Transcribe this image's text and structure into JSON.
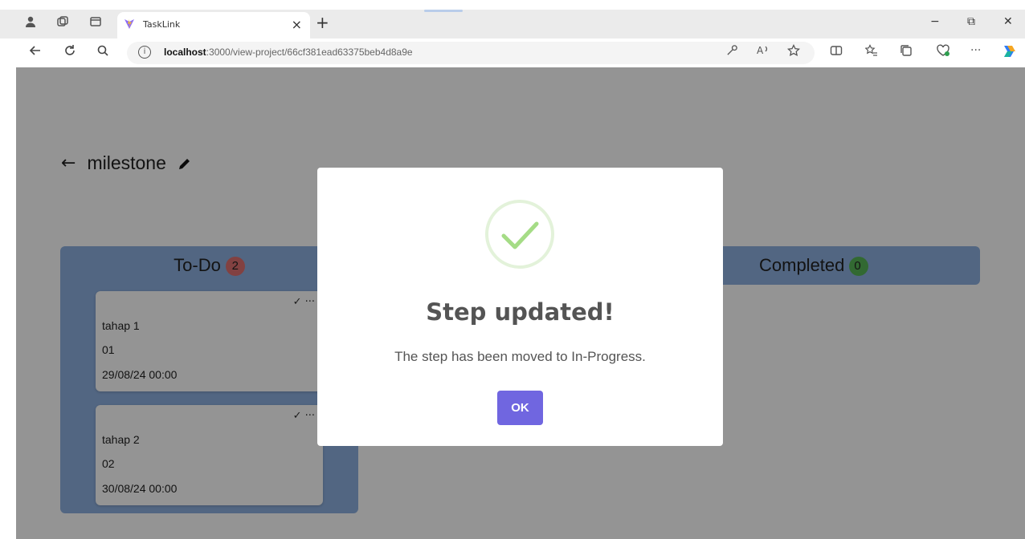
{
  "browser": {
    "tab_title": "TaskLink",
    "tab_close": "×",
    "new_tab": "+",
    "url_host": "localhost",
    "url_path": ":3000/view-project/66cf381ead63375beb4d8a9e",
    "window_minimize": "−",
    "window_restore": "⧉",
    "window_close": "✕",
    "more_label": "···"
  },
  "page": {
    "project_title": "milestone",
    "back_arrow": "←"
  },
  "board": {
    "columns": [
      {
        "name": "To-Do",
        "count": "2"
      },
      {
        "name": "Completed",
        "count": "0"
      }
    ],
    "cards": [
      {
        "title": "tahap 1",
        "number": "01",
        "date": "29/08/24 00:00",
        "actions": "✓ ···"
      },
      {
        "title": "tahap 2",
        "number": "02",
        "date": "30/08/24 00:00",
        "actions": "✓ ···"
      }
    ]
  },
  "modal": {
    "title": "Step updated!",
    "message": "The step has been moved to In-Progress.",
    "ok_label": "OK"
  },
  "colors": {
    "overlay": "#000000",
    "confirm_button": "#7066e0",
    "success_check": "#a5dc86",
    "column_bg": "#8eb0e0",
    "badge_red": "#e07070",
    "badge_green": "#57b657"
  }
}
